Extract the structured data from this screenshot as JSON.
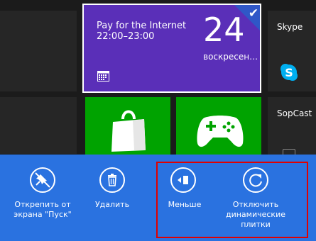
{
  "calendar_tile": {
    "title": "Pay for the Internet",
    "time": "22:00–23:00",
    "day": "24",
    "weekday": "воскресен…"
  },
  "apps": {
    "skype": "Skype",
    "sopcast": "SopCast"
  },
  "app_bar": {
    "unpin_label": "Открепить от экрана \"Пуск\"",
    "remove_label": "Удалить",
    "smaller_label": "Меньше",
    "disable_live_label": "Отключить динамические плитки"
  },
  "colors": {
    "accent": "#2a72e0",
    "calendar": "#5a2fb8",
    "store": "#00a300",
    "highlight": "#e00000"
  }
}
